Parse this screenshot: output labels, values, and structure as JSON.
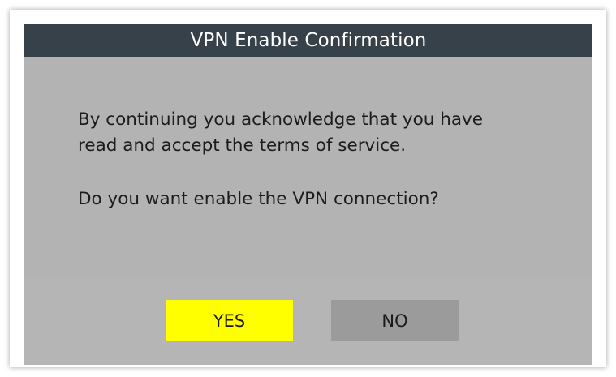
{
  "dialog": {
    "title": "VPN Enable Confirmation",
    "message_line1": "By continuing you acknowledge that you have",
    "message_line2": "read and accept the terms of service.",
    "question": "Do you want enable the VPN connection?",
    "buttons": {
      "yes_label": "YES",
      "no_label": "NO"
    }
  },
  "colors": {
    "titlebar": "#364149",
    "dialog_background": "#b3b3b3",
    "yes_button": "#ffff00",
    "no_button": "#9b9b9b",
    "text": "#1c1c1c"
  }
}
